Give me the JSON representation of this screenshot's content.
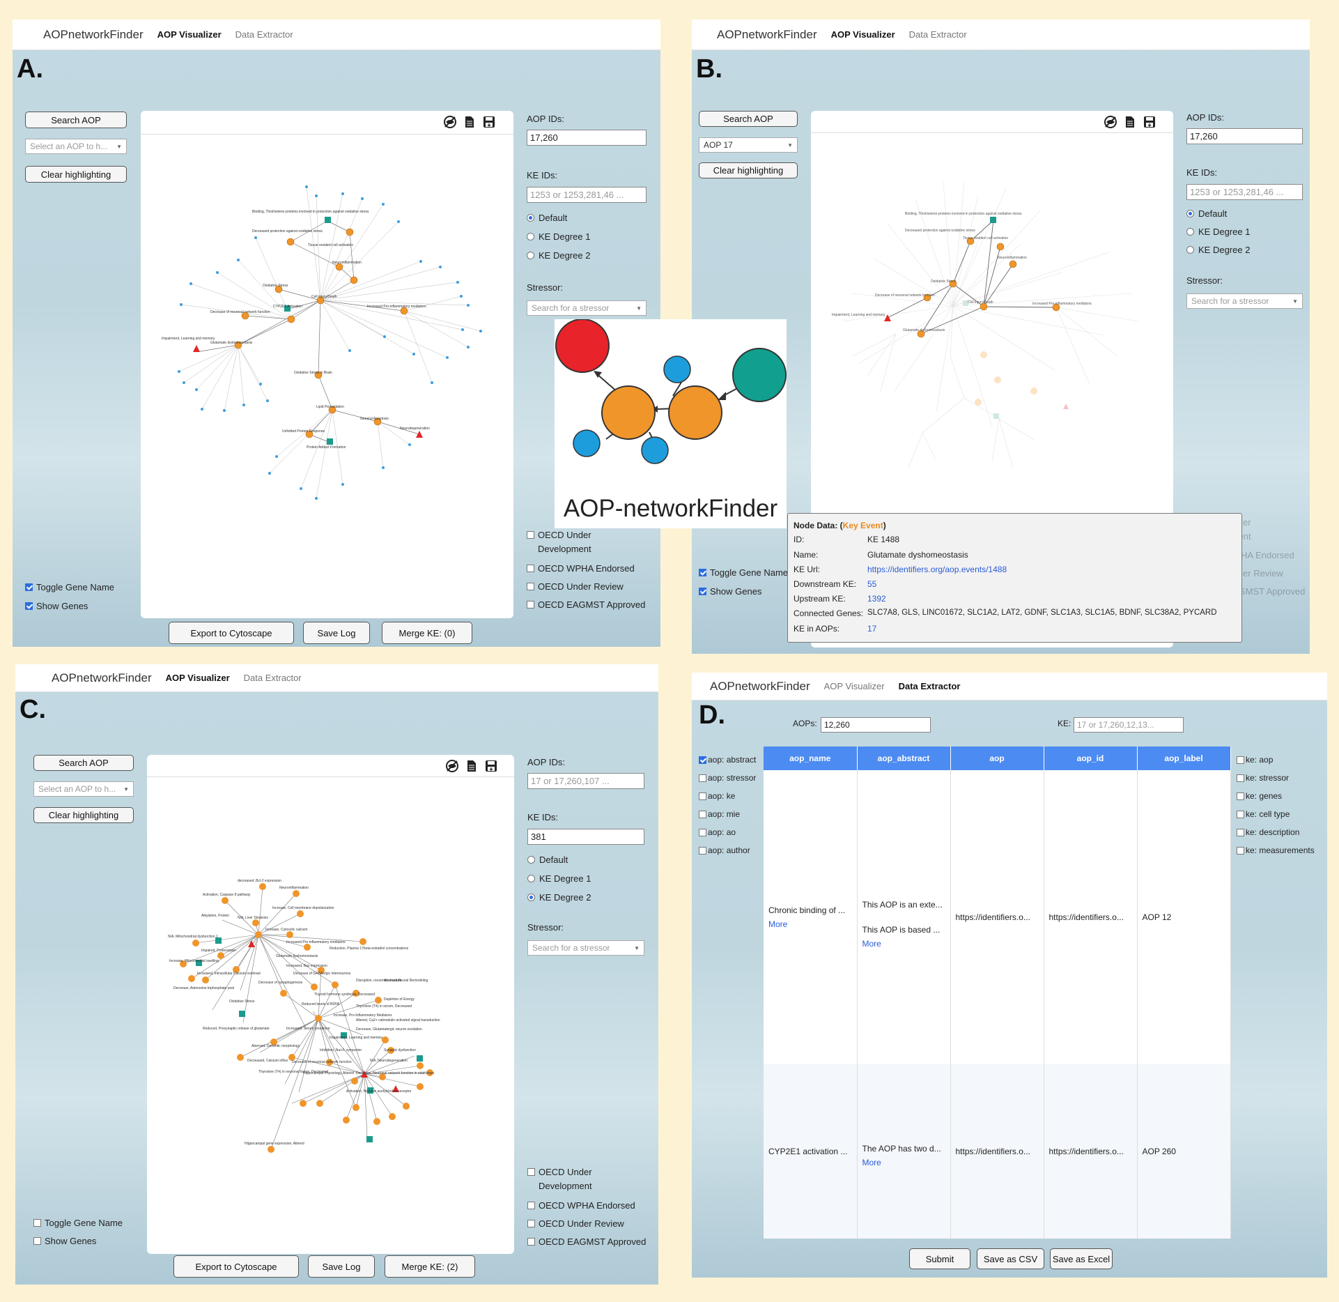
{
  "app": {
    "brand": "AOPnetworkFinder",
    "nav_visualizer": "AOP Visualizer",
    "nav_extractor": "Data Extractor"
  },
  "colors": {
    "key_event": "#f0952a",
    "ao": "#e02626",
    "gene": "#3d9de0",
    "mie": "#1a9b8c",
    "header": "#4c8bf1"
  },
  "common": {
    "search_aop": "Search AOP",
    "select_placeholder": "Select an AOP to h...",
    "clear_highlighting": "Clear highlighting",
    "aop_ids_label": "AOP IDs:",
    "ke_ids_label": "KE IDs:",
    "ke_placeholder": "1253 or 1253,281,46 ...",
    "aop_placeholder": "17 or 17,260,107 ...",
    "radio_default": "Default",
    "radio_deg1": "KE Degree 1",
    "radio_deg2": "KE Degree 2",
    "stressor_label": "Stressor:",
    "stressor_placeholder": "Search for a stressor",
    "oecd_dev": "OECD Under Development",
    "oecd_wpha": "OECD WPHA Endorsed",
    "oecd_review": "OECD Under Review",
    "oecd_eagmst": "OECD EAGMST Approved",
    "toggle_gene": "Toggle Gene Name",
    "show_genes": "Show Genes",
    "export": "Export to Cytoscape",
    "save_log": "Save Log"
  },
  "panel_a": {
    "letter": "A.",
    "aop_ids": "17,260",
    "merge": "Merge KE: (0)"
  },
  "panel_b": {
    "letter": "B.",
    "aop_ids": "17,260",
    "selected_aop": "AOP 17",
    "tooltip": {
      "title_prefix": "Node Data: (",
      "title_type": "Key Event",
      "title_suffix": ")",
      "rows": [
        {
          "k": "ID:",
          "v": "KE 1488"
        },
        {
          "k": "Name:",
          "v": "Glutamate dyshomeostasis"
        },
        {
          "k": "KE Url:",
          "v": "https://identifiers.org/aop.events/1488"
        },
        {
          "k": "Downstream KE:",
          "v": "55"
        },
        {
          "k": "Upstream KE:",
          "v": "1392"
        },
        {
          "k": "Connected Genes:",
          "v": "SLC7A8, GLS, LINC01672, SLC1A2, LAT2, GDNF, SLC1A3, SLC1A5, BDNF, SLC38A2, PYCARD"
        },
        {
          "k": "KE in AOPs:",
          "v": "17"
        }
      ]
    }
  },
  "panel_c": {
    "letter": "C.",
    "ke_ids": "381",
    "merge": "Merge KE: (2)"
  },
  "panel_d": {
    "letter": "D.",
    "aops_label": "AOPs:",
    "aops_value": "12,260",
    "ke_label": "KE:",
    "ke_placeholder": "17 or 17,260,12,13...",
    "aop_checks": [
      "aop: abstract",
      "aop: stressor",
      "aop: ke",
      "aop: mie",
      "aop: ao",
      "aop: author"
    ],
    "ke_checks": [
      "ke: aop",
      "ke: stressor",
      "ke: genes",
      "ke: cell type",
      "ke: description",
      "ke: measurements"
    ],
    "columns": [
      "aop_name",
      "aop_abstract",
      "aop",
      "aop_id",
      "aop_label"
    ],
    "rows": [
      {
        "name": "Chronic binding of ...",
        "abstract1": "This AOP is an exte...",
        "abstract2": "This AOP is based ...",
        "aop": "https://identifiers.o...",
        "aop_id": "https://identifiers.o...",
        "label": "AOP 12"
      },
      {
        "name": "CYP2E1 activation ...",
        "abstract1": "The AOP has two d...",
        "abstract2": "",
        "aop": "https://identifiers.o...",
        "aop_id": "https://identifiers.o...",
        "label": "AOP 260"
      }
    ],
    "more": "More",
    "submit": "Submit",
    "save_csv": "Save as CSV",
    "save_excel": "Save as Excel"
  },
  "logo": {
    "text": "AOP-networkFinder"
  },
  "graph_a_labels": [
    "Binding, Thiol/seleno-proteins involved in protection against oxidative stress",
    "Decreased protection against oxidative stress",
    "Tissue resident cell activation",
    "Neuroinflammation",
    "Oxidative Stress",
    "Decrease of neuronal network function",
    "Cell injury/Death",
    "Increased Pro-inflammatory mediators",
    "Impairment, Learning and memory",
    "Glutamate dyshomeostasis",
    "Oxidative Stress in Brain",
    "Lipid Peroxidation",
    "General Apoptosis",
    "Unfolded Protein Response",
    "Protein Adduct Formation",
    "Neurodegeneration",
    "CYP2E1 Activation"
  ],
  "graph_c_labels": [
    "decreased, Bcl-2 expression",
    "Neuroinflammation",
    "Activation, Caspase 8 pathway",
    "Increase, Cell membrane depolarization",
    "Alkylation, Protein",
    "N/A, Liver Steatosis",
    "Increase, Cytosolic calcium",
    "Increased Pro-inflammatory mediators",
    "N/A, Mitochondrial dysfunction 1",
    "Glutamate dyshomeostasis",
    "Reduction, Plasma 17beta-estradiol concentrations",
    "Impaired, Proteostasis",
    "Increase, Mitochondrial swelling",
    "Increased, Bax expression",
    "Decrease of GABAergic interneurons",
    "Increased, Intracellular Calcium overload",
    "Decrease of synaptogenesis",
    "Disruption, neuronal structure",
    "Aberrant Neural Remodeling",
    "Decrease, Adenosine triphosphate pool",
    "Thyroid hormone synthesis, Decreased",
    "Depletion of Energy",
    "Oxidative Stress",
    "Reduced levels of BDNF",
    "Thyroxine (T4) in serum, Decreased",
    "Increase, Pro-Inflammatory Mediators",
    "Altered, Ca2+ calmodulin activated signal transduction",
    "Reduced, Presynaptic release of glutamate",
    "Increased, Serum creatinine",
    "Decrease, Glutamatergic neuron excitation",
    "Impairment, Learning and memory",
    "Aberrant, Dendritic morphology",
    "Inhibition, Na+/I- symporter",
    "Synaptic dysfunction",
    "N/A, Neurodegeneration",
    "Decreased, Calcium influx",
    "Decrease of neuronal network function",
    "Thyroxine (T4) in neuronal tissue, Decreased",
    "Hippocampal Physiology, Altered",
    "Decrease, Neuronal network function in adult brain",
    "Activation, Nicotinic acetylcholine receptor",
    "Hippocampal gene expression, Altered"
  ],
  "graph_b_labels": [
    "Binding, Thiol/seleno-proteins involved in protection against oxidative stress",
    "Decreased protection against oxidative stress",
    "Tissue resident cell activation",
    "Neuroinflammation",
    "Oxidative Stress",
    "Decrease of neuronal network function",
    "Cell injury/Death",
    "Increased Pro-inflammatory mediators",
    "Impairment, Learning and memory",
    "Glutamate dyshomeostasis"
  ]
}
